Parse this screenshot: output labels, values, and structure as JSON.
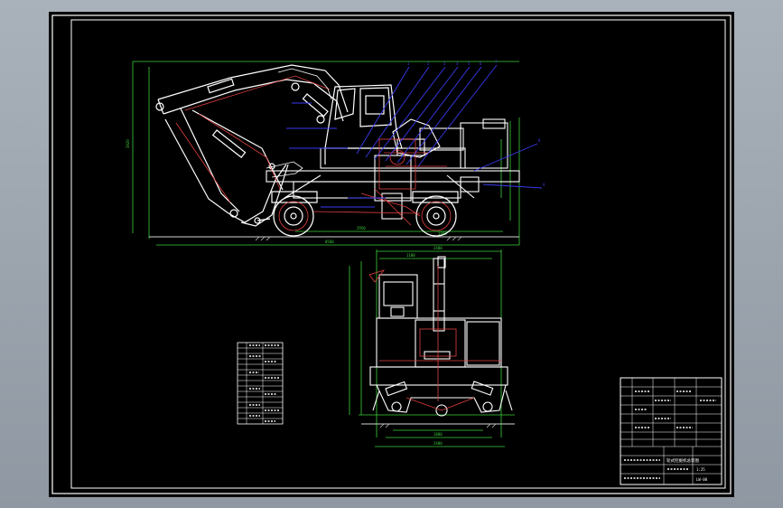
{
  "drawing": {
    "side_view": {
      "dims": {
        "height": "3920",
        "overall_length": "8560",
        "wheelbase": "2950",
        "track_rear": "1880",
        "span": "4300"
      },
      "callouts": [
        "1",
        "2",
        "3",
        "4",
        "5",
        "6",
        "7",
        "8",
        "9",
        "10",
        "11",
        "12",
        "13",
        "14",
        "15",
        "16",
        "17",
        "18"
      ]
    },
    "front_view": {
      "dims": {
        "width_top": "2480",
        "cab_width": "1180",
        "track": "1880",
        "base_width": "2480"
      }
    },
    "title_block": {
      "title": "轮式挖掘机总装图",
      "drawing_no": "LW-00",
      "scale": "1:25"
    },
    "colors": {
      "background": "#000000",
      "frame": "#ffffff",
      "dim": "#3cd13c",
      "outline": "#ffffff",
      "hidden": "#e04040",
      "leader": "#3a3af0",
      "ground": "#d3d3d3"
    }
  }
}
